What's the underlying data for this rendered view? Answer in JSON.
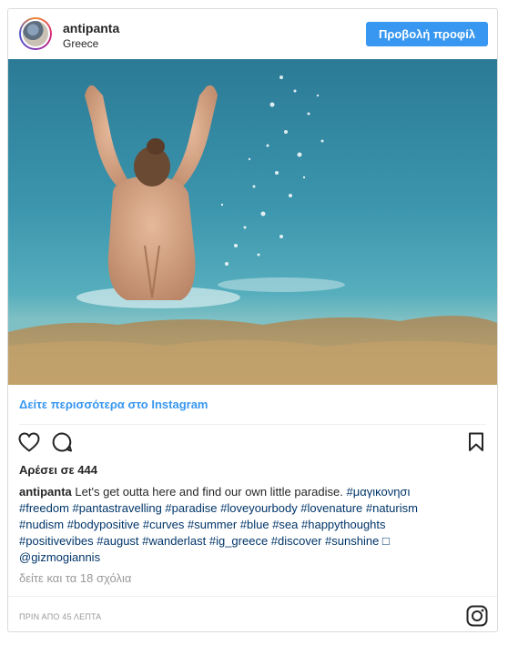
{
  "header": {
    "username": "antipanta",
    "location": "Greece",
    "profile_button": "Προβολή προφίλ"
  },
  "photo": {
    "description_icon": "beach-photo"
  },
  "more_link": "Δείτε περισσότερα στο Instagram",
  "actions": {
    "like_icon": "heart-icon",
    "comment_icon": "comment-icon",
    "save_icon": "bookmark-icon"
  },
  "likes": "Αρέσει σε 444",
  "caption": {
    "user": "antipanta",
    "text": "Let's get outta here and find our own little paradise.",
    "line1_tags": "#μαγικονησι",
    "line2": "#freedom #pantastravelling #paradise #loveyourbody #lovenature #naturism",
    "line3": "#nudism #bodypositive #curves #summer #blue #sea #happythoughts",
    "line4": "#positivevibes #august #wanderlast #ig_greece #discover #sunshine □",
    "line5": "@gizmogiannis"
  },
  "comments_link": "δείτε και τα 18 σχόλια",
  "timestamp": "ΠΡΙΝ ΑΠΟ 45 ΛΕΠΤΑ",
  "colors": {
    "accent": "#3897f0",
    "hashtag": "#003569",
    "muted": "#999999",
    "border": "#dbdbdb"
  }
}
